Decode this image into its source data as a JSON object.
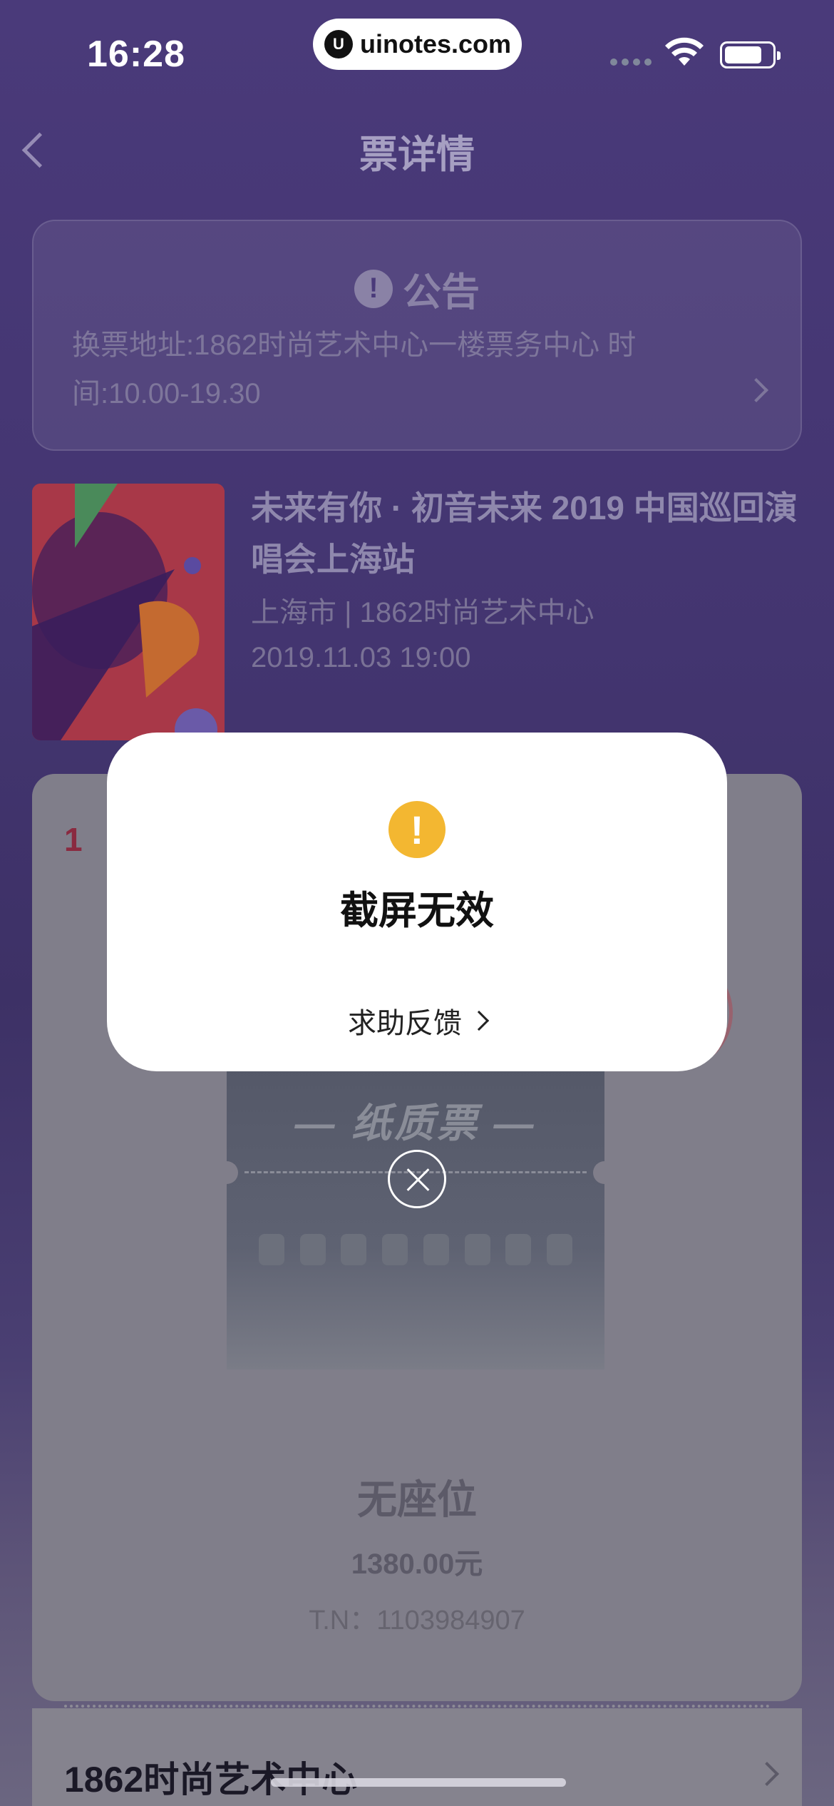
{
  "status_bar": {
    "time": "16:28",
    "url": "uinotes.com",
    "url_logo": "U"
  },
  "nav": {
    "title": "票详情"
  },
  "notice": {
    "icon": "!",
    "title": "公告",
    "body": "换票地址:1862时尚艺术中心一楼票务中心 时间:10.00-19.30"
  },
  "event": {
    "title": "未来有你 · 初音未来 2019 中国巡回演唱会上海站",
    "venue": "上海市 | 1862时尚艺术中心",
    "datetime": "2019.11.03 19:00"
  },
  "ticket": {
    "red_mark": "1",
    "paper_label": "— 纸质票 —",
    "seat": "无座位",
    "price": "1380.00元",
    "tn": "T.N：1103984907"
  },
  "venue_card": {
    "name": "1862时尚艺术中心"
  },
  "dialog": {
    "icon": "!",
    "title": "截屏无效",
    "link": "求助反馈"
  },
  "colors": {
    "accent_warning": "#f3b731",
    "bg": "#4a3a7a"
  }
}
